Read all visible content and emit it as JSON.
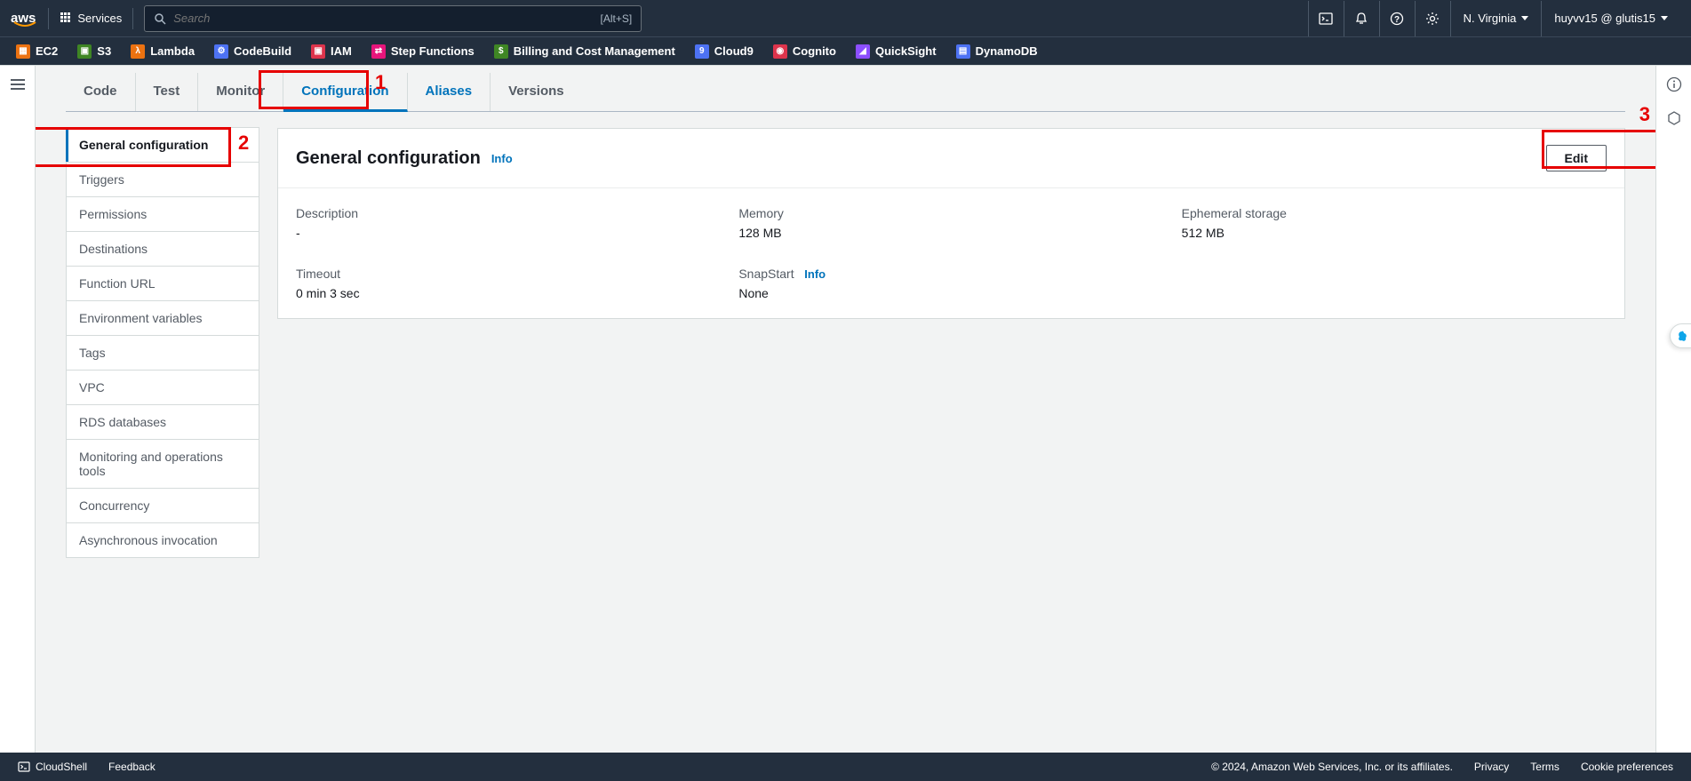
{
  "topnav": {
    "logo_text": "aws",
    "services_label": "Services",
    "search_placeholder": "Search",
    "search_shortcut": "[Alt+S]",
    "region": "N. Virginia",
    "account": "huyvv15 @ glutis15"
  },
  "favorites": [
    {
      "label": "EC2",
      "color": "#ec7211"
    },
    {
      "label": "S3",
      "color": "#3f8624"
    },
    {
      "label": "Lambda",
      "color": "#ec7211"
    },
    {
      "label": "CodeBuild",
      "color": "#4d72f3"
    },
    {
      "label": "IAM",
      "color": "#dd344c"
    },
    {
      "label": "Step Functions",
      "color": "#e7157b"
    },
    {
      "label": "Billing and Cost Management",
      "color": "#3f8624"
    },
    {
      "label": "Cloud9",
      "color": "#4d72f3"
    },
    {
      "label": "Cognito",
      "color": "#dd344c"
    },
    {
      "label": "QuickSight",
      "color": "#8c4fff"
    },
    {
      "label": "DynamoDB",
      "color": "#4d72f3"
    }
  ],
  "tabs": [
    "Code",
    "Test",
    "Monitor",
    "Configuration",
    "Aliases",
    "Versions"
  ],
  "active_tab": "Configuration",
  "sidenav": [
    "General configuration",
    "Triggers",
    "Permissions",
    "Destinations",
    "Function URL",
    "Environment variables",
    "Tags",
    "VPC",
    "RDS databases",
    "Monitoring and operations tools",
    "Concurrency",
    "Asynchronous invocation"
  ],
  "active_sidenav": "General configuration",
  "panel": {
    "title": "General configuration",
    "info": "Info",
    "edit": "Edit",
    "fields": {
      "description": {
        "label": "Description",
        "value": "-"
      },
      "memory": {
        "label": "Memory",
        "value": "128  MB"
      },
      "ephemeral": {
        "label": "Ephemeral storage",
        "value": "512  MB"
      },
      "timeout": {
        "label": "Timeout",
        "value": "0  min  3  sec"
      },
      "snapstart": {
        "label": "SnapStart",
        "info": "Info",
        "value": "None"
      }
    }
  },
  "annotations": {
    "a1": "1",
    "a2": "2",
    "a3": "3"
  },
  "footer": {
    "cloudshell": "CloudShell",
    "feedback": "Feedback",
    "copyright": "© 2024, Amazon Web Services, Inc. or its affiliates.",
    "privacy": "Privacy",
    "terms": "Terms",
    "cookies": "Cookie preferences"
  }
}
